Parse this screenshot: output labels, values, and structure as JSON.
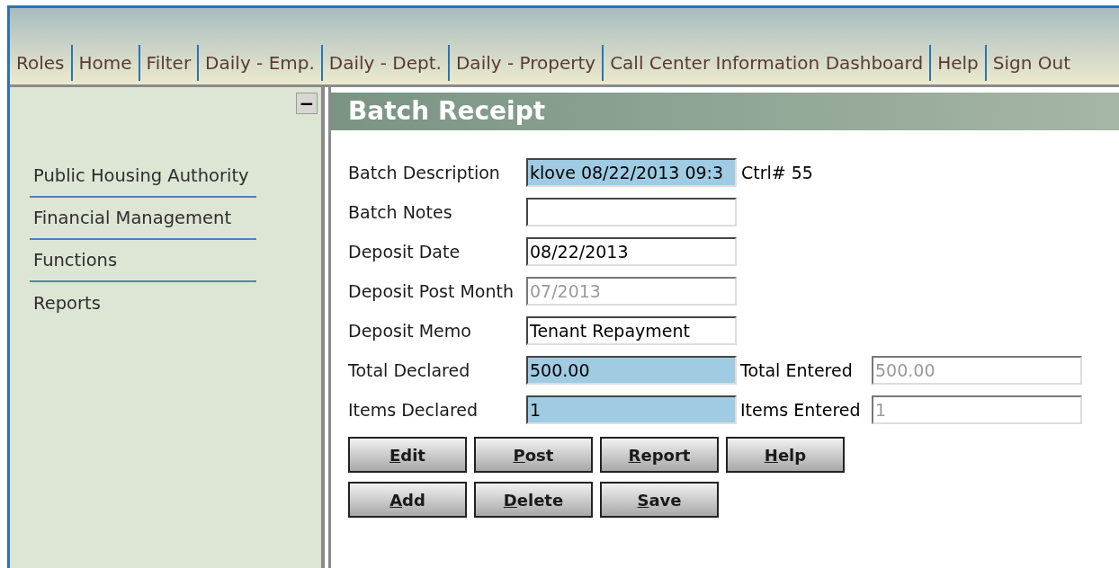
{
  "nav": [
    {
      "label": "Roles"
    },
    {
      "label": "Home"
    },
    {
      "label": "Filter"
    },
    {
      "label": "Daily - Emp."
    },
    {
      "label": "Daily - Dept."
    },
    {
      "label": "Daily - Property"
    },
    {
      "label": "Call Center Information Dashboard"
    },
    {
      "label": "Help"
    },
    {
      "label": "Sign Out"
    }
  ],
  "sidebar": {
    "collapse_button": "−",
    "items": [
      {
        "label": "Public Housing Authority"
      },
      {
        "label": "Financial Management"
      },
      {
        "label": "Functions"
      },
      {
        "label": "Reports"
      }
    ]
  },
  "panel": {
    "title": "Batch Receipt",
    "fields": [
      {
        "label": "Batch Description",
        "value": "klove 08/22/2013 09:3",
        "highlighted": true,
        "disabled": false,
        "suffix": "Ctrl# 55"
      },
      {
        "label": "Batch Notes",
        "highlighted": false,
        "disabled": false
      },
      {
        "label": "Deposit Date",
        "value": "08/22/2013",
        "highlighted": false,
        "disabled": false
      },
      {
        "label": "Deposit Post Month",
        "value": "07/2013",
        "highlighted": false,
        "disabled": true
      },
      {
        "label": "Deposit Memo",
        "value": "Tenant Repayment",
        "highlighted": false,
        "disabled": false
      },
      {
        "label": "Total Declared",
        "value": "500.00",
        "highlighted": true,
        "disabled": false,
        "side": {
          "label": "Total Entered",
          "value": "500.00",
          "disabled": true
        }
      },
      {
        "label": "Items Declared",
        "value": "1",
        "highlighted": true,
        "disabled": false,
        "side": {
          "label": "Items Entered",
          "value": "1",
          "disabled": true
        }
      }
    ],
    "button_rows": [
      [
        {
          "label": "Edit"
        },
        {
          "label": "Post"
        },
        {
          "label": "Report"
        },
        {
          "label": "Help"
        }
      ],
      [
        {
          "label": "Add"
        },
        {
          "label": "Delete"
        },
        {
          "label": "Save"
        }
      ]
    ]
  }
}
